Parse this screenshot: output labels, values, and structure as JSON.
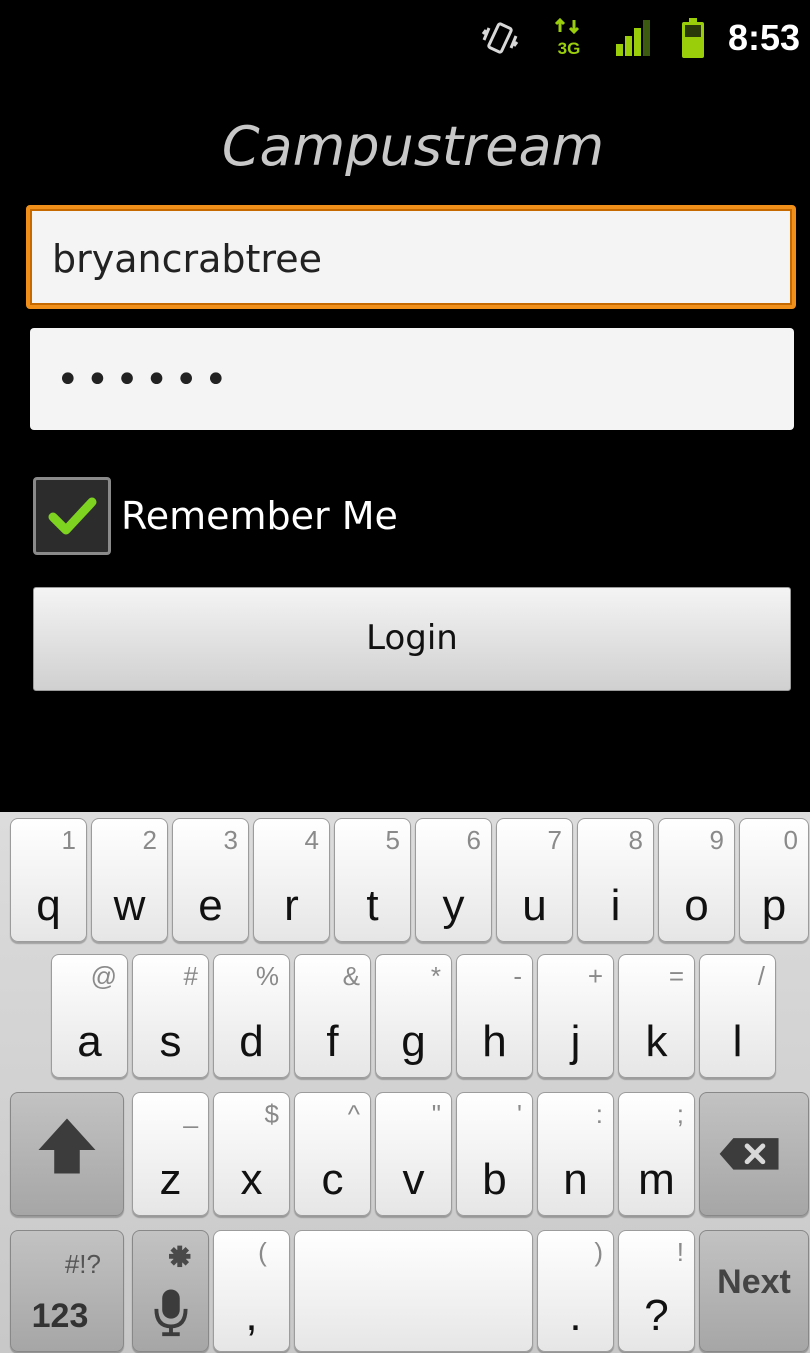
{
  "status_bar": {
    "time": "8:53",
    "network_label": "3G",
    "icons": [
      "vibrate-icon",
      "data-3g-icon",
      "signal-icon",
      "battery-icon"
    ],
    "accent_color": "#9acd0a"
  },
  "app": {
    "title": "Campustream"
  },
  "form": {
    "username_value": "bryancrabtree",
    "password_value": "••••••",
    "remember_label": "Remember Me",
    "remember_checked": true,
    "login_label": "Login",
    "focus_color": "#f0901a"
  },
  "keyboard": {
    "row1": [
      {
        "main": "q",
        "alt": "1"
      },
      {
        "main": "w",
        "alt": "2"
      },
      {
        "main": "e",
        "alt": "3"
      },
      {
        "main": "r",
        "alt": "4"
      },
      {
        "main": "t",
        "alt": "5"
      },
      {
        "main": "y",
        "alt": "6"
      },
      {
        "main": "u",
        "alt": "7"
      },
      {
        "main": "i",
        "alt": "8"
      },
      {
        "main": "o",
        "alt": "9"
      },
      {
        "main": "p",
        "alt": "0"
      }
    ],
    "row2": [
      {
        "main": "a",
        "alt": "@"
      },
      {
        "main": "s",
        "alt": "#"
      },
      {
        "main": "d",
        "alt": "%"
      },
      {
        "main": "f",
        "alt": "&"
      },
      {
        "main": "g",
        "alt": "*"
      },
      {
        "main": "h",
        "alt": "-"
      },
      {
        "main": "j",
        "alt": "+"
      },
      {
        "main": "k",
        "alt": "="
      },
      {
        "main": "l",
        "alt": "/"
      }
    ],
    "row3": [
      {
        "main": "z",
        "alt": "_"
      },
      {
        "main": "x",
        "alt": "$"
      },
      {
        "main": "c",
        "alt": "^"
      },
      {
        "main": "v",
        "alt": "\""
      },
      {
        "main": "b",
        "alt": "'"
      },
      {
        "main": "n",
        "alt": ":"
      },
      {
        "main": "m",
        "alt": ";"
      }
    ],
    "symbols_key": {
      "main": "123",
      "alt": "#!?"
    },
    "comma_key": {
      "main": ",",
      "alt": "("
    },
    "period_key": {
      "main": ".",
      "alt": ")"
    },
    "question_key": {
      "main": "?",
      "alt": "!"
    },
    "next_label": "Next",
    "shift_icon": "shift-arrow-icon",
    "backspace_icon": "backspace-icon",
    "mic_icon": "microphone-icon",
    "settings_icon": "gear-icon"
  }
}
